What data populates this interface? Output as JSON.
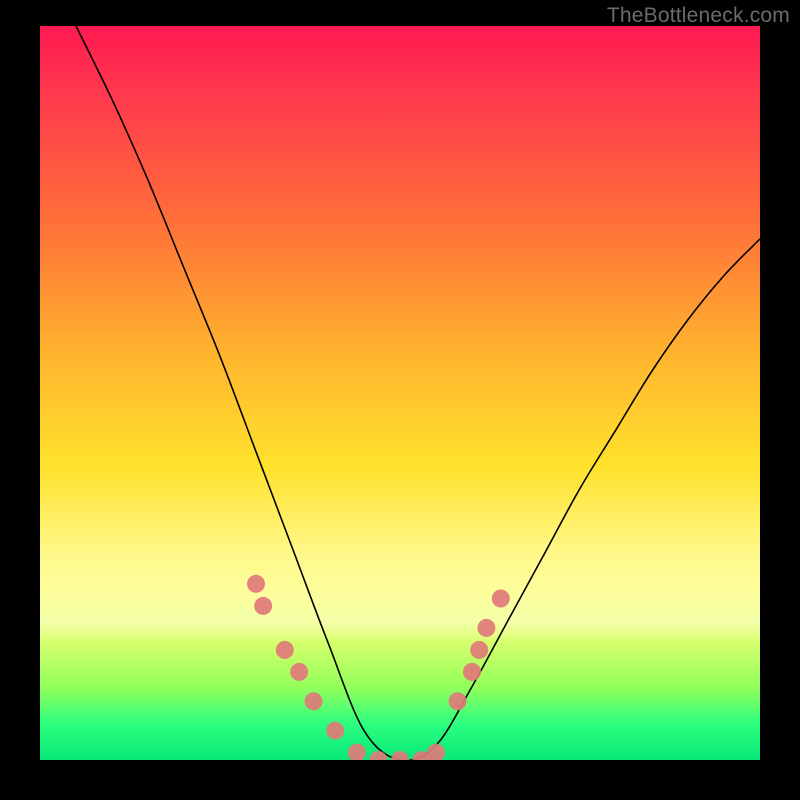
{
  "watermark": "TheBottleneck.com",
  "colors": {
    "gradient_top": "#ff1a52",
    "gradient_bottom": "#07e877",
    "dot": "#e07a7a",
    "curve": "#000000",
    "frame": "#000000"
  },
  "chart_data": {
    "type": "line",
    "title": "",
    "xlabel": "",
    "ylabel": "",
    "xlim": [
      0,
      100
    ],
    "ylim": [
      0,
      100
    ],
    "grid": false,
    "curve_note": "V-shaped bottleneck curve; y is approximate bottleneck percentage (higher = worse). Minimum ~0 near x≈45–55.",
    "series": [
      {
        "name": "bottleneck-curve",
        "x": [
          5,
          10,
          15,
          20,
          25,
          30,
          35,
          40,
          45,
          50,
          55,
          60,
          65,
          70,
          75,
          80,
          85,
          90,
          95,
          100
        ],
        "y": [
          100,
          90,
          79,
          67,
          55,
          42,
          29,
          16,
          4,
          0,
          2,
          10,
          19,
          28,
          37,
          45,
          53,
          60,
          66,
          71
        ]
      }
    ],
    "markers_note": "Salmon dots clustered along the curve near the valley (roughly x 30–65, y 0–25).",
    "markers": [
      {
        "x": 30,
        "y": 24
      },
      {
        "x": 31,
        "y": 21
      },
      {
        "x": 34,
        "y": 15
      },
      {
        "x": 36,
        "y": 12
      },
      {
        "x": 38,
        "y": 8
      },
      {
        "x": 41,
        "y": 4
      },
      {
        "x": 44,
        "y": 1
      },
      {
        "x": 47,
        "y": 0
      },
      {
        "x": 50,
        "y": 0
      },
      {
        "x": 53,
        "y": 0
      },
      {
        "x": 55,
        "y": 1
      },
      {
        "x": 58,
        "y": 8
      },
      {
        "x": 60,
        "y": 12
      },
      {
        "x": 61,
        "y": 15
      },
      {
        "x": 62,
        "y": 18
      },
      {
        "x": 64,
        "y": 22
      }
    ]
  }
}
